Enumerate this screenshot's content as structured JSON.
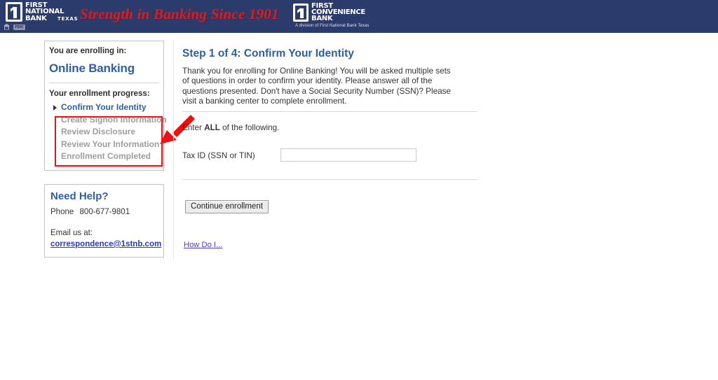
{
  "header": {
    "primary_logo": {
      "numeral": "1",
      "line1": "FIRST",
      "line2": "NATIONAL",
      "line3": "BANK",
      "state": "TEXAS"
    },
    "tagline": "Strength in Banking Since 1901",
    "secondary_logo": {
      "numeral": "1",
      "line1": "FIRST",
      "line2": "CONVENIENCE",
      "line3": "BANK",
      "division_note": "A division of First National Bank Texas"
    },
    "icons": {
      "equal_housing": "equal-housing-lender-icon",
      "fdic": "FDIC"
    },
    "background_color": "#2b3b6b",
    "tagline_color": "#c62433"
  },
  "sidebar": {
    "enrollment_panel": {
      "lead": "You are enrolling in:",
      "product": "Online Banking",
      "progress_lead": "Your enrollment progress:",
      "steps": [
        {
          "label": "Confirm Your Identity",
          "state": "current"
        },
        {
          "label": "Create Signon Information",
          "state": "pending"
        },
        {
          "label": "Review Disclosure",
          "state": "pending"
        },
        {
          "label": "Review Your Information",
          "state": "pending"
        },
        {
          "label": "Enrollment Completed",
          "state": "pending"
        }
      ]
    },
    "help_panel": {
      "title": "Need Help?",
      "phone_label": "Phone",
      "phone_number": "800-677-9801",
      "email_lead": "Email us at:",
      "email": "correspondence@1stnb.com"
    }
  },
  "annotation": {
    "box_color": "#ee1111",
    "arrow_color": "#ee1111",
    "target": "pending enrollment steps"
  },
  "main": {
    "title": "Step 1 of 4: Confirm Your Identity",
    "intro": "Thank you for enrolling for Online Banking! You will be asked multiple sets of questions in order to confirm your identity. Please answer all of the questions presented. Don't have a Social Security Number (SSN)? Please visit a banking center to complete enrollment.",
    "instruction_prefix": "Enter ",
    "instruction_emphasis": "ALL",
    "instruction_suffix": " of the following.",
    "fields": [
      {
        "label": "Tax ID (SSN or TIN)",
        "value": "",
        "placeholder": ""
      }
    ],
    "continue_button": "Continue enrollment",
    "help_link": "How Do I..."
  }
}
